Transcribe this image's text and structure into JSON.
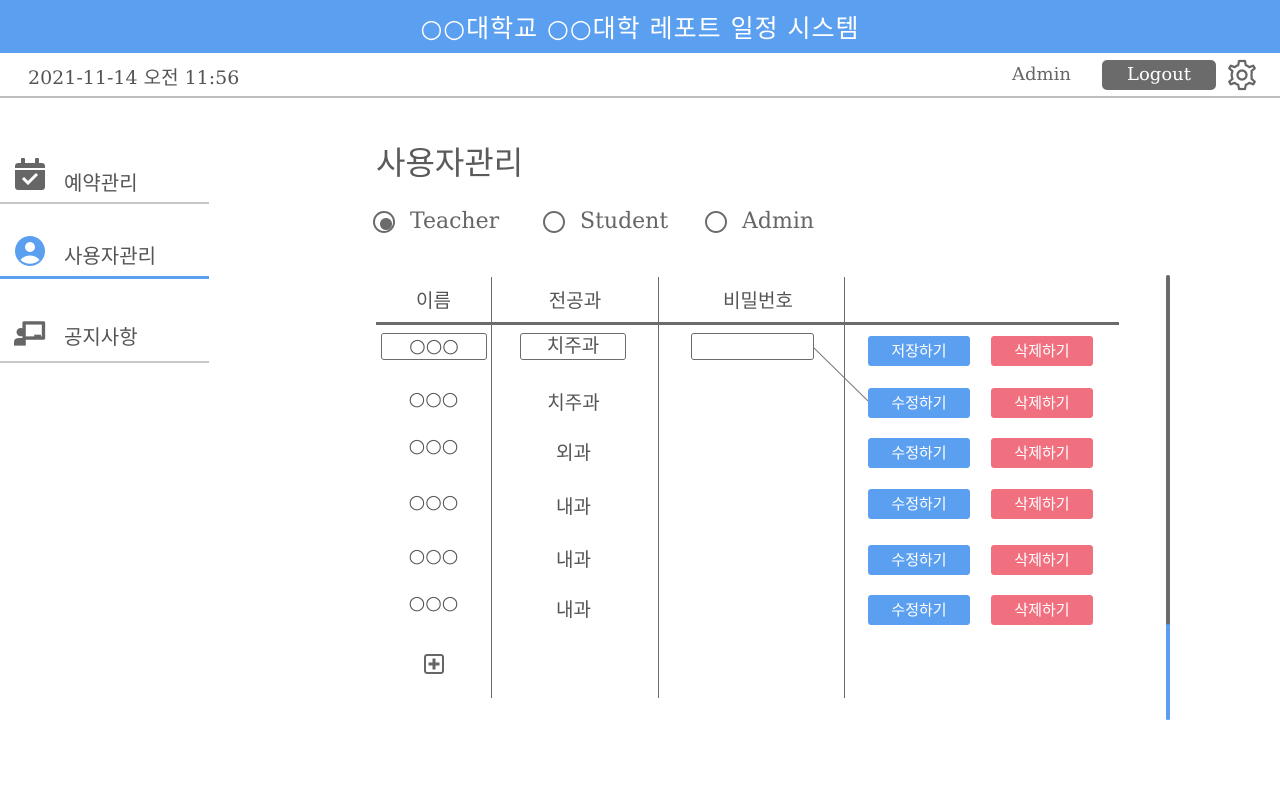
{
  "app": {
    "title": "○○대학교 ○○대학 레포트 일정 시스템"
  },
  "header": {
    "datetime": "2021-11-14 오전 11:56",
    "username": "Admin",
    "logout_label": "Logout",
    "settings_icon": "gear-icon"
  },
  "sidebar": {
    "items": [
      {
        "label": "예약관리",
        "icon": "calendar-check-icon"
      },
      {
        "label": "사용자관리",
        "icon": "user-circle-icon",
        "active": true
      },
      {
        "label": "공지사항",
        "icon": "chalkboard-teacher-icon"
      }
    ]
  },
  "main": {
    "title": "사용자관리",
    "roles": [
      {
        "label": "Teacher",
        "selected": true
      },
      {
        "label": "Student",
        "selected": false
      },
      {
        "label": "Admin",
        "selected": false
      }
    ],
    "table": {
      "headers": [
        "이름",
        "전공과",
        "비밀번호",
        ""
      ],
      "edit_row": {
        "name": "○○○",
        "major": "치주과",
        "password": "",
        "save_label": "저장하기",
        "delete_label": "삭제하기"
      },
      "rows": [
        {
          "name": "○○○",
          "major": "치주과",
          "edit_label": "수정하기",
          "delete_label": "삭제하기"
        },
        {
          "name": "○○○",
          "major": "외과",
          "edit_label": "수정하기",
          "delete_label": "삭제하기"
        },
        {
          "name": "○○○",
          "major": "내과",
          "edit_label": "수정하기",
          "delete_label": "삭제하기"
        },
        {
          "name": "○○○",
          "major": "내과",
          "edit_label": "수정하기",
          "delete_label": "삭제하기"
        },
        {
          "name": "○○○",
          "major": "내과",
          "edit_label": "수정하기",
          "delete_label": "삭제하기"
        }
      ],
      "add_icon": "plus-square-icon"
    }
  },
  "colors": {
    "accent": "#5b9ff0",
    "danger": "#f0707f",
    "dark": "#6b6b6b"
  }
}
